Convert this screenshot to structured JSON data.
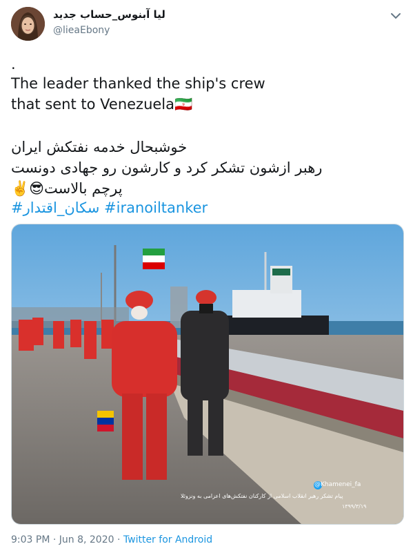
{
  "tweet": {
    "display_name": "لیا آبنوس_حساب جدید",
    "handle": "@lieaEbony",
    "menu_icon": "chevron-down-icon",
    "lines": [
      ".",
      "The leader thanked the ship's crew",
      "that sent to Venezuela🇮🇷",
      "خوشبحال خدمه نفتکش ایران",
      "رهبر ازشون تشکر کرد و کارشون رو جهادی دونست",
      "پرچم بالاست😎✌️"
    ],
    "hashtags": [
      "#سکان_اقتدار",
      "#iranoiltanker"
    ],
    "timestamp": "9:03 PM · Jun 8, 2020",
    "separator": " · ",
    "source": "Twitter for Android"
  },
  "media": {
    "watermark_handle": "@Khamenei_fa",
    "caption_line1": "پیام تشکر رهبر انقلاب اسلامی از کارکنان نفتکش‌های اعزامی به ونزوئلا",
    "caption_line2": "۱۳۹۹/۳/۱۹"
  }
}
